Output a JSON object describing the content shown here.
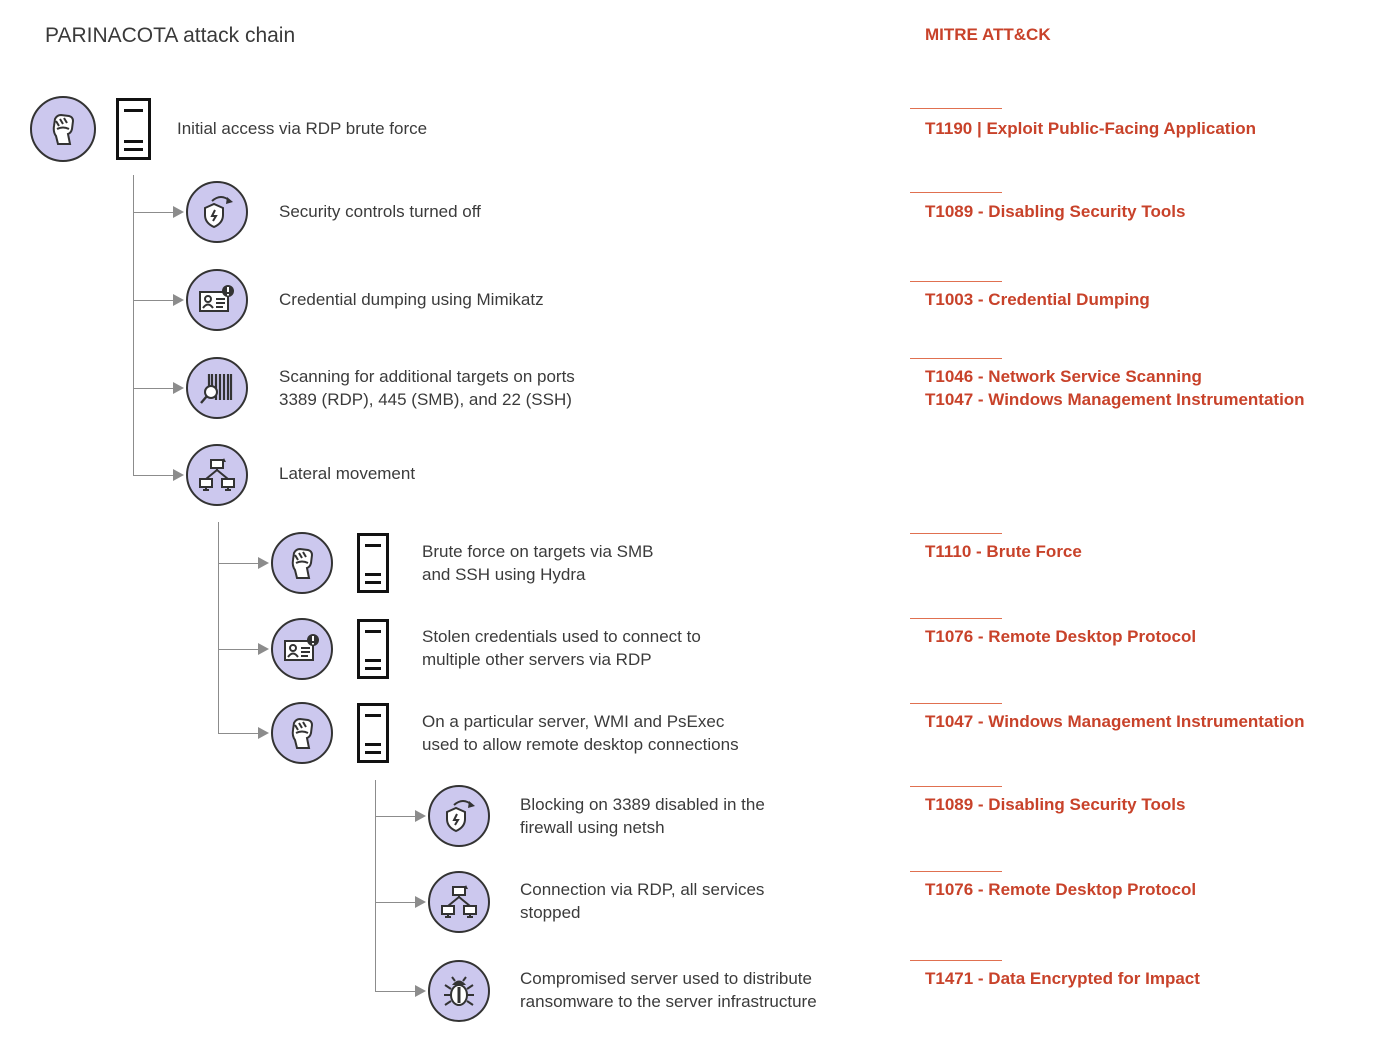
{
  "header": {
    "title": "PARINACOTA attack chain",
    "mitre_title": "MITRE ATT&CK"
  },
  "colors": {
    "accent": "#c8422a",
    "icon_fill": "#ccc8ee",
    "connector": "#8c8c8c"
  },
  "steps": [
    {
      "text": "Initial access via RDP brute force",
      "icon": "fist-icon",
      "server": true,
      "technique": "T1190 | Exploit Public-Facing Application"
    },
    {
      "text": "Security controls turned off",
      "icon": "shield-redirect-icon",
      "server": false,
      "technique": "T1089 - Disabling Security Tools"
    },
    {
      "text": "Credential dumping using Mimikatz",
      "icon": "id-card-alert-icon",
      "server": false,
      "technique": "T1003 - Credential Dumping"
    },
    {
      "text": "Scanning for additional targets on ports\n3389 (RDP), 445 (SMB), and 22 (SSH)",
      "icon": "barcode-scan-icon",
      "server": false,
      "technique": "T1046 - Network Service Scanning\nT1047 - Windows Management Instrumentation"
    },
    {
      "text": "Lateral movement",
      "icon": "network-icon",
      "server": false,
      "technique": ""
    },
    {
      "text": "Brute force on targets via SMB\nand SSH using Hydra",
      "icon": "fist-icon",
      "server": true,
      "technique": "T1110 - Brute Force"
    },
    {
      "text": "Stolen credentials used to connect to\nmultiple other servers via RDP",
      "icon": "id-card-alert-icon",
      "server": true,
      "technique": "T1076 - Remote Desktop Protocol"
    },
    {
      "text": "On a particular server, WMI and PsExec\nused to allow remote desktop connections",
      "icon": "fist-icon",
      "server": true,
      "technique": "T1047 - Windows Management Instrumentation"
    },
    {
      "text": "Blocking on 3389 disabled in the\nfirewall using netsh",
      "icon": "shield-redirect-icon",
      "server": false,
      "technique": "T1089 - Disabling Security Tools"
    },
    {
      "text": "Connection via RDP, all services\nstopped",
      "icon": "network-icon",
      "server": false,
      "technique": "T1076 - Remote Desktop Protocol"
    },
    {
      "text": "Compromised server used to distribute\nransomware to the server infrastructure",
      "icon": "bug-icon",
      "server": false,
      "technique": "T1471 - Data Encrypted for Impact"
    }
  ]
}
